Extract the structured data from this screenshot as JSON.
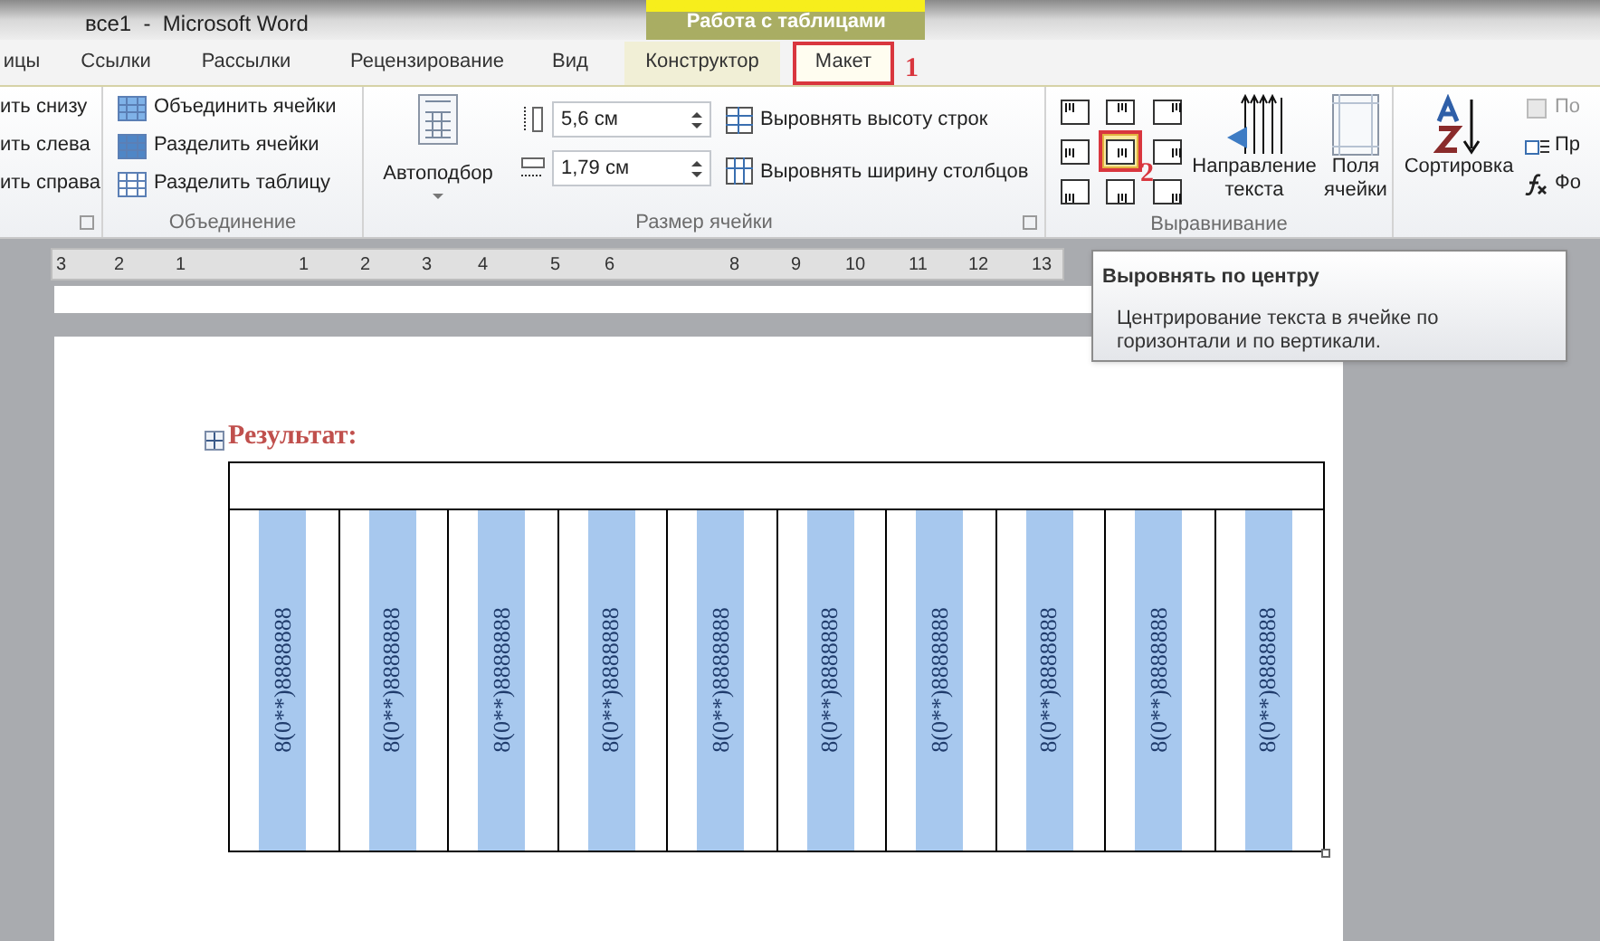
{
  "window": {
    "title": "все1  -  Microsoft Word",
    "context_group": "Работа с таблицами"
  },
  "tabs": [
    {
      "label": "ицы",
      "selected": false,
      "context": false
    },
    {
      "label": "Ссылки",
      "selected": false,
      "context": false
    },
    {
      "label": "Рассылки",
      "selected": false,
      "context": false
    },
    {
      "label": "Рецензирование",
      "selected": false,
      "context": false
    },
    {
      "label": "Вид",
      "selected": false,
      "context": false
    },
    {
      "label": "Конструктор",
      "selected": false,
      "context": true
    },
    {
      "label": "Макет",
      "selected": true,
      "context": true
    }
  ],
  "step_marks": [
    "1",
    "2"
  ],
  "rows_group": {
    "items": [
      "ить снизу",
      "ить слева",
      "ить справа"
    ]
  },
  "merge_group": {
    "label": "Объединение",
    "items": [
      "Объединить ячейки",
      "Разделить ячейки",
      "Разделить таблицу"
    ]
  },
  "cell_size_group": {
    "label": "Размер ячейки",
    "autofit": "Автоподбор",
    "height": "5,6 см",
    "width": "1,79 см",
    "buttons": [
      "Выровнять высоту строк",
      "Выровнять ширину столбцов"
    ]
  },
  "alignment_group": {
    "label": "Выравнивание",
    "alignments": [
      {
        "selected": false
      },
      {
        "selected": false
      },
      {
        "selected": false
      },
      {
        "selected": false
      },
      {
        "selected": true
      },
      {
        "selected": false
      },
      {
        "selected": false
      },
      {
        "selected": false
      },
      {
        "selected": false
      }
    ],
    "text_direction": [
      "Направление",
      "текста"
    ],
    "cell_margins": [
      "Поля",
      "ячейки"
    ]
  },
  "data_group": {
    "sort": "Сортировка",
    "items": [
      "По",
      "Пр",
      "Фо"
    ]
  },
  "ruler": [
    "3",
    "2",
    "1",
    "1",
    "2",
    "3",
    "4",
    "5",
    "6",
    "8",
    "9",
    "10",
    "11",
    "12",
    "13"
  ],
  "tooltip": {
    "title": "Выровнять по центру",
    "body": "Центрирование текста в ячейке по горизонтали и по вертикали."
  },
  "document": {
    "heading": "Результат:",
    "cells": [
      {
        "text": "8(0**)8888888",
        "highlighted": true
      },
      {
        "text": "8(0**)8888888",
        "highlighted": true
      },
      {
        "text": "8(0**)8888888",
        "highlighted": true
      },
      {
        "text": "8(0**)8888888",
        "highlighted": true
      },
      {
        "text": "8(0**)8888888",
        "highlighted": true
      },
      {
        "text": "8(0**)8888888",
        "highlighted": true
      },
      {
        "text": "8(0**)8888888",
        "highlighted": true
      },
      {
        "text": "8(0**)8888888",
        "highlighted": true
      },
      {
        "text": "8(0**)8888888",
        "highlighted": true
      },
      {
        "text": "8(0**)8888888",
        "highlighted": true
      }
    ]
  }
}
